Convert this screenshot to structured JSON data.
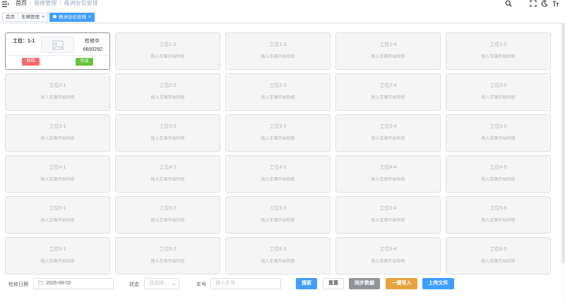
{
  "header": {
    "breadcrumbs": [
      "首页",
      "报修管理",
      "株洲台位安排"
    ]
  },
  "tags": [
    {
      "label": "首页",
      "active": false
    },
    {
      "label": "车辆管理",
      "active": false,
      "close": "×"
    },
    {
      "label": "株洲台位安排",
      "active": true,
      "close": "×"
    }
  ],
  "occupied_slot": {
    "title": "工位：1-1",
    "status": "检修中",
    "plate": "6600292",
    "remove_label": "移除",
    "done_label": "完成"
  },
  "empty_hint": "拖入车辆开始检修",
  "slots": [
    "工位1-2",
    "工位1-3",
    "工位1-4",
    "工位1-5",
    "工位2-1",
    "工位2-2",
    "工位2-3",
    "工位2-4",
    "工位2-5",
    "工位3-1",
    "工位3-2",
    "工位3-3",
    "工位3-4",
    "工位3-5",
    "工位4-1",
    "工位4-2",
    "工位4-3",
    "工位4-4",
    "工位4-5",
    "工位5-1",
    "工位5-2",
    "工位5-3",
    "工位5-4",
    "工位5-5",
    "工位6-1",
    "工位6-2",
    "工位6-3",
    "工位6-4",
    "工位6-5"
  ],
  "filters": {
    "date_label": "检修日期",
    "date_value": "2025-09-02",
    "status_label": "状态",
    "status_placeholder": "请选择...",
    "plate_label": "车号",
    "plate_placeholder": "输入车号",
    "search": "搜索",
    "reset": "重置",
    "sync": "同步数据",
    "import": "一键导入",
    "upload": "上传文件"
  },
  "colors": {
    "primary": "#409eff",
    "danger": "#f56c6c",
    "success": "#67c23a",
    "info": "#909399",
    "warning": "#e6a23c"
  },
  "icons": [
    "hamburger-icon",
    "search-icon",
    "fullscreen-icon",
    "moon-icon",
    "font-size-icon",
    "image-placeholder-icon",
    "calendar-icon",
    "chevron-down-icon"
  ]
}
